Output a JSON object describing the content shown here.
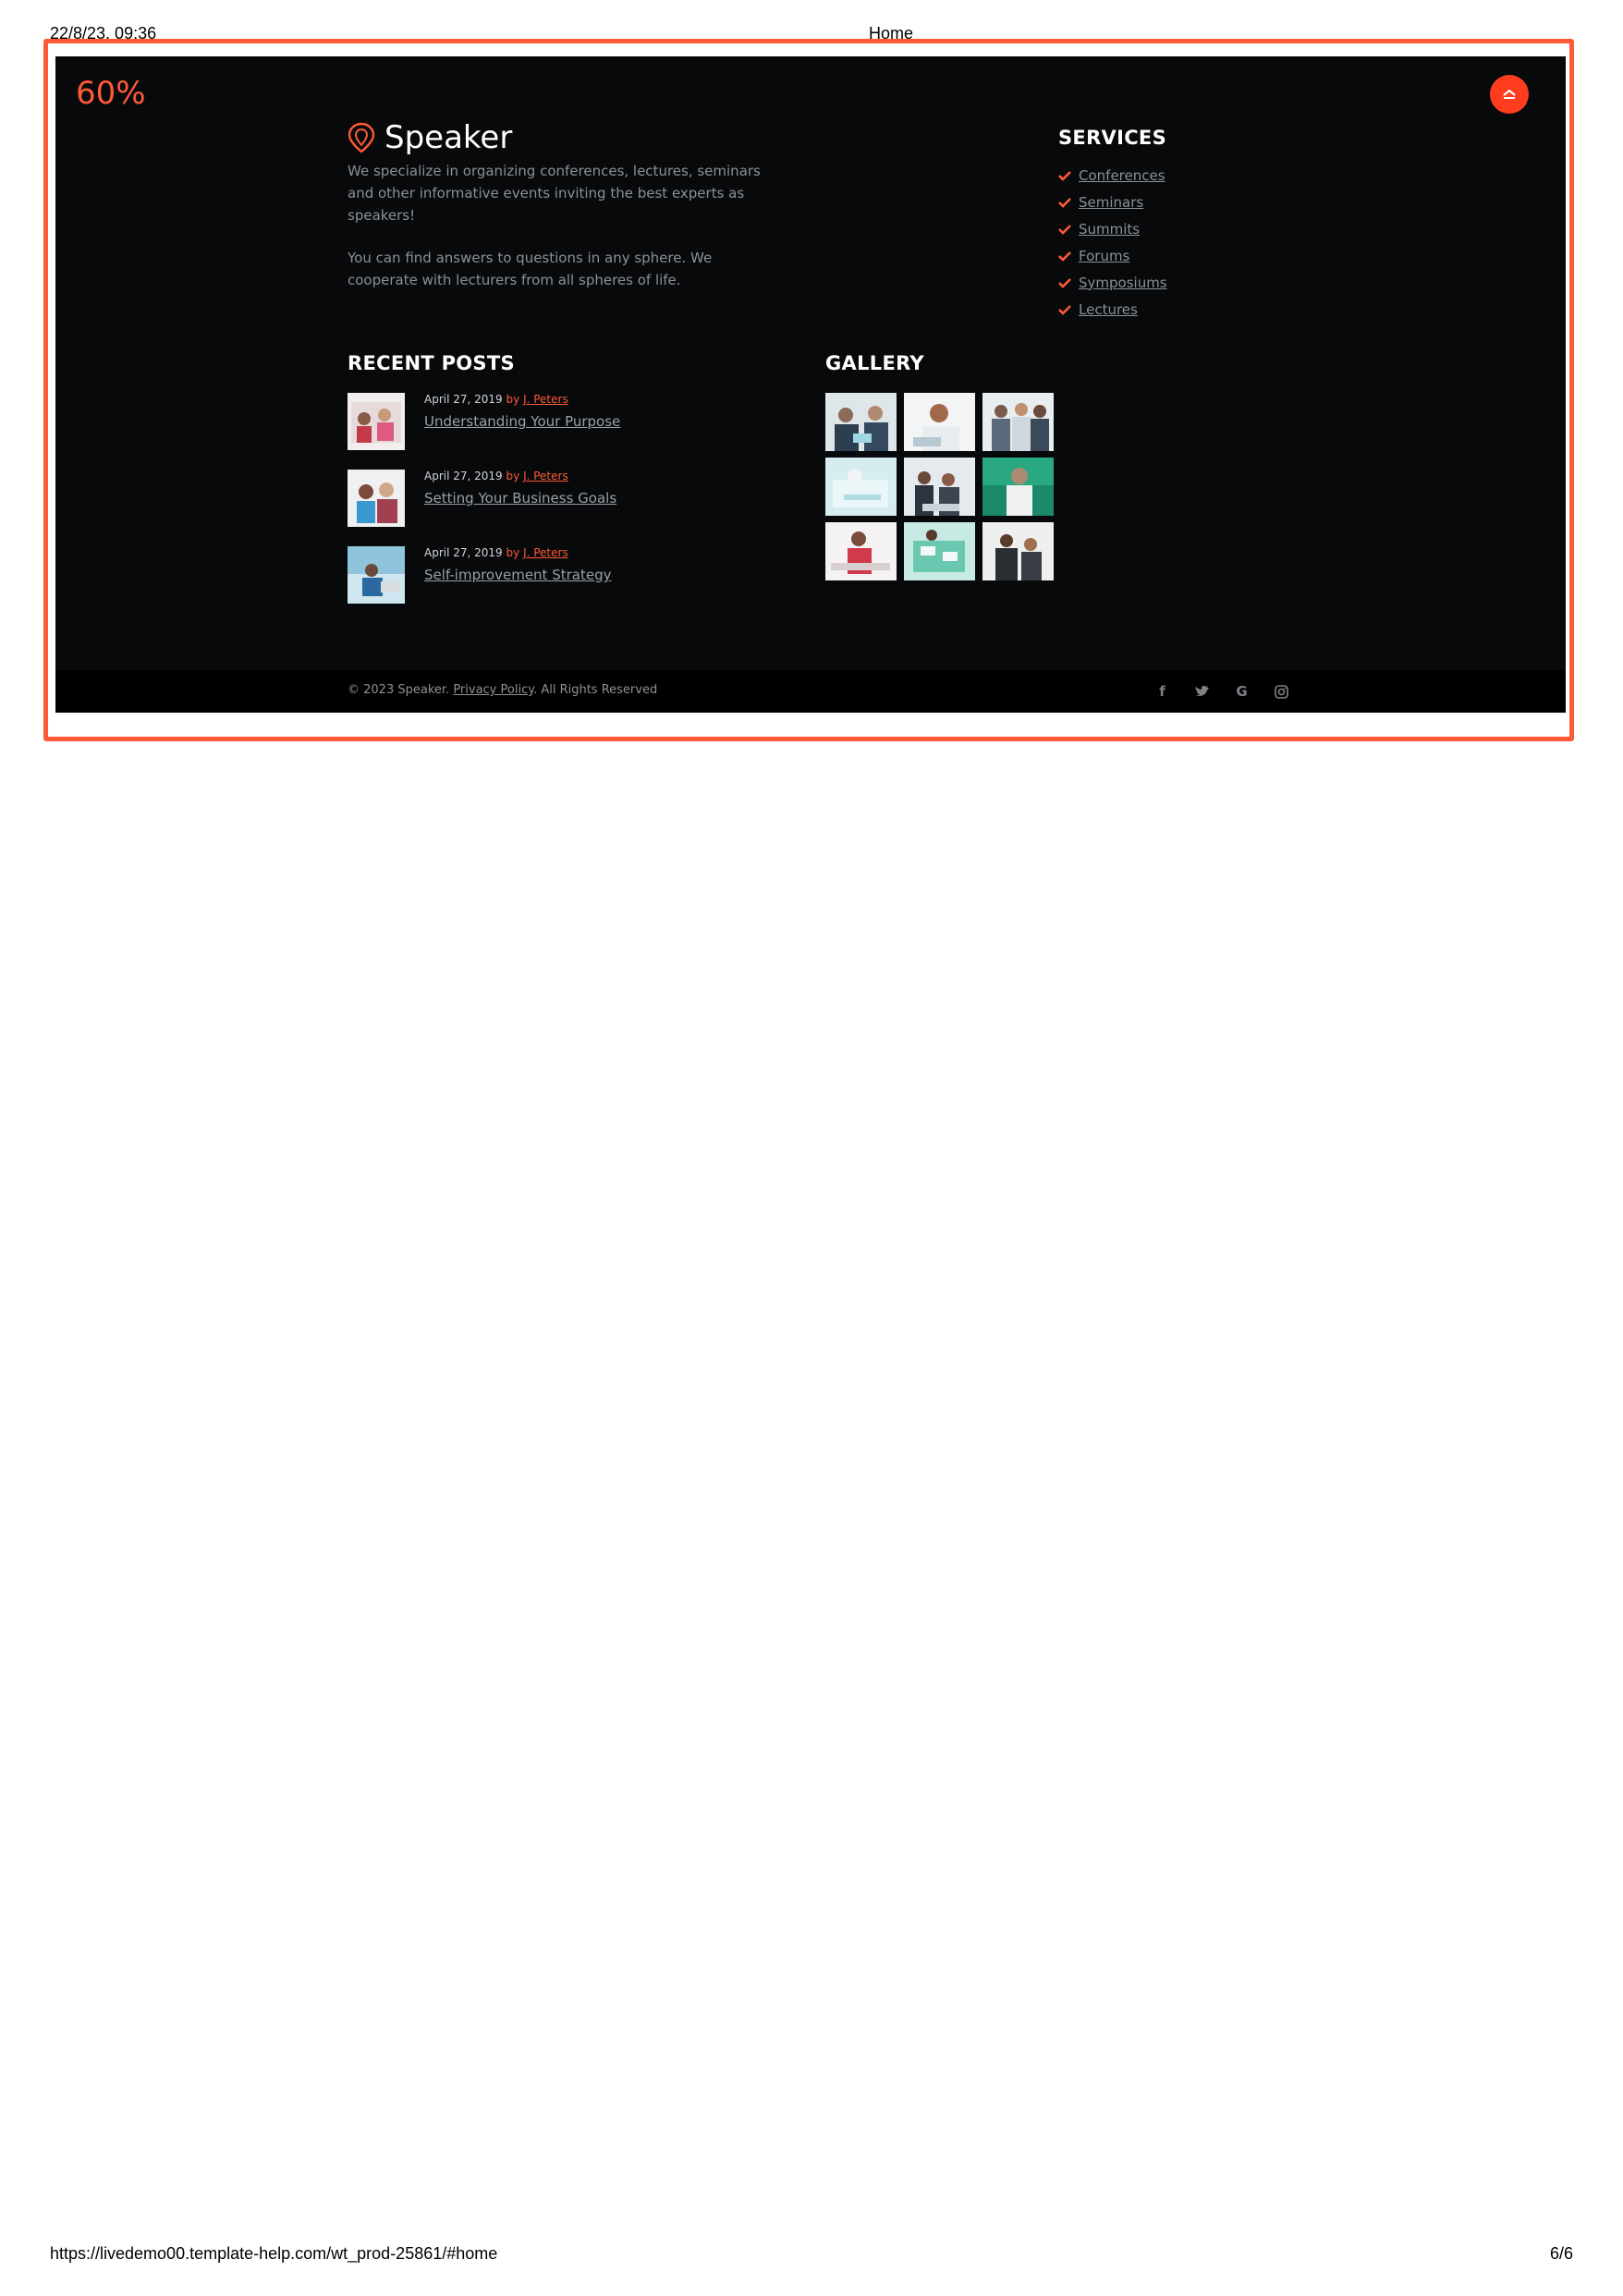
{
  "print_header": {
    "datetime": "22/8/23, 09:36",
    "title": "Home"
  },
  "print_footer": {
    "url": "https://livedemo00.template-help.com/wt_prod-25861/#home",
    "page": "6/6"
  },
  "zoom_label": "60%",
  "brand": {
    "name": "Speaker"
  },
  "about": {
    "p1": "We specialize in organizing conferences, lectures, seminars and other informative events inviting the best experts as speakers!",
    "p2": "You can find answers to questions in any sphere. We cooperate with lecturers from all spheres of life."
  },
  "services": {
    "title": "SERVICES",
    "items": [
      {
        "label": "Conferences"
      },
      {
        "label": "Seminars"
      },
      {
        "label": "Summits"
      },
      {
        "label": "Forums"
      },
      {
        "label": "Symposiums"
      },
      {
        "label": "Lectures"
      }
    ]
  },
  "recent_posts": {
    "title": "RECENT POSTS",
    "posts": [
      {
        "date": "April 27, 2019",
        "by": "by",
        "author": "J. Peters",
        "title": "Understanding Your Purpose"
      },
      {
        "date": "April 27, 2019",
        "by": "by",
        "author": "J. Peters",
        "title": "Setting Your Business Goals"
      },
      {
        "date": "April 27, 2019",
        "by": "by",
        "author": "J. Peters",
        "title": "Self-improvement Strategy"
      }
    ]
  },
  "gallery": {
    "title": "GALLERY"
  },
  "footer": {
    "copyright_prefix": "© 2023 Speaker.",
    "privacy_label": "Privacy Policy",
    "copyright_suffix": ". All Rights Reserved",
    "social": [
      {
        "name": "facebook-icon",
        "glyph": "f"
      },
      {
        "name": "twitter-icon",
        "glyph": "t"
      },
      {
        "name": "google-icon",
        "glyph": "G"
      },
      {
        "name": "instagram-icon",
        "glyph": "◎"
      }
    ]
  },
  "colors": {
    "accent": "#ff5a36",
    "background": "#07090b",
    "bottom_bar": "#000000",
    "muted_text": "#8c9196"
  }
}
